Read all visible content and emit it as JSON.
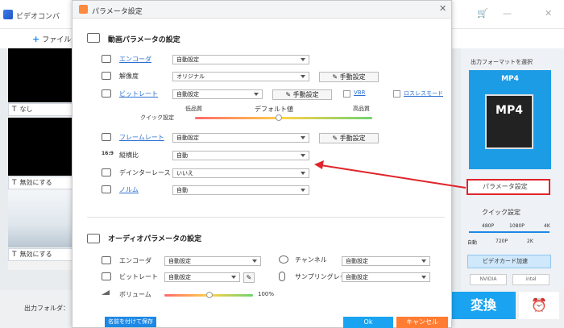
{
  "app": {
    "title": "ビデオコンバ",
    "add_file": "ファイル追",
    "close": "✕",
    "minimize": "—",
    "cart": "🛒"
  },
  "left": {
    "captions": [
      "なし",
      "無効にする",
      "無効にする"
    ]
  },
  "bottom": {
    "output_folder": "出力フォルダ：",
    "convert": "変換",
    "alarm": "⏰"
  },
  "right": {
    "format_title": "出力フォーマットを選択",
    "format": "MP4",
    "format_img_text": "MP4",
    "param_button": "パラメータ設定",
    "quick_setting": "クイック設定",
    "res_top": [
      "480P",
      "1080P",
      "4K"
    ],
    "res_bottom": [
      "自動",
      "720P",
      "2K"
    ],
    "gpu": "ビデオカード加速",
    "brands": [
      "NVIDIA",
      "intel"
    ]
  },
  "dialog": {
    "title": "パラメータ設定",
    "close": "✕",
    "video_section": "動画パラメータの設定",
    "encoder_label": "エンコーダ",
    "encoder_value": "自動設定",
    "resolution_label": "解像度",
    "resolution_value": "オリジナル",
    "manual": "手動設定",
    "bitrate_label": "ビットレート",
    "bitrate_value": "自動設定",
    "vbr": "VBR",
    "lossless": "ロスレスモード",
    "quick_label": "クイック設定",
    "low": "低品質",
    "default": "デフォルト値",
    "high": "高品質",
    "framerate_label": "フレームレート",
    "framerate_value": "自動設定",
    "aspect_label": "縦横比",
    "aspect_value": "自動",
    "deinterlace_label": "デインターレース",
    "deinterlace_value": "いいえ",
    "norm_label": "ノルム",
    "norm_value": "自動",
    "audio_section": "オーディオパラメータの設定",
    "a_encoder_label": "エンコーダ",
    "a_encoder_value": "自動設定",
    "channel_label": "チャンネル",
    "channel_value": "自動設定",
    "a_bitrate_label": "ビットレート",
    "a_bitrate_value": "自動設定",
    "sample_label": "サンプリングレート",
    "sample_value": "自動設定",
    "volume_label": "ボリューム",
    "volume_value": "100%",
    "save_as": "名前を付けて保存",
    "ok": "Ok",
    "cancel": "キャンセル"
  },
  "colors": {
    "accent": "#1aa3f0",
    "highlight": "#e0242b",
    "cancel": "#ff7c32"
  }
}
